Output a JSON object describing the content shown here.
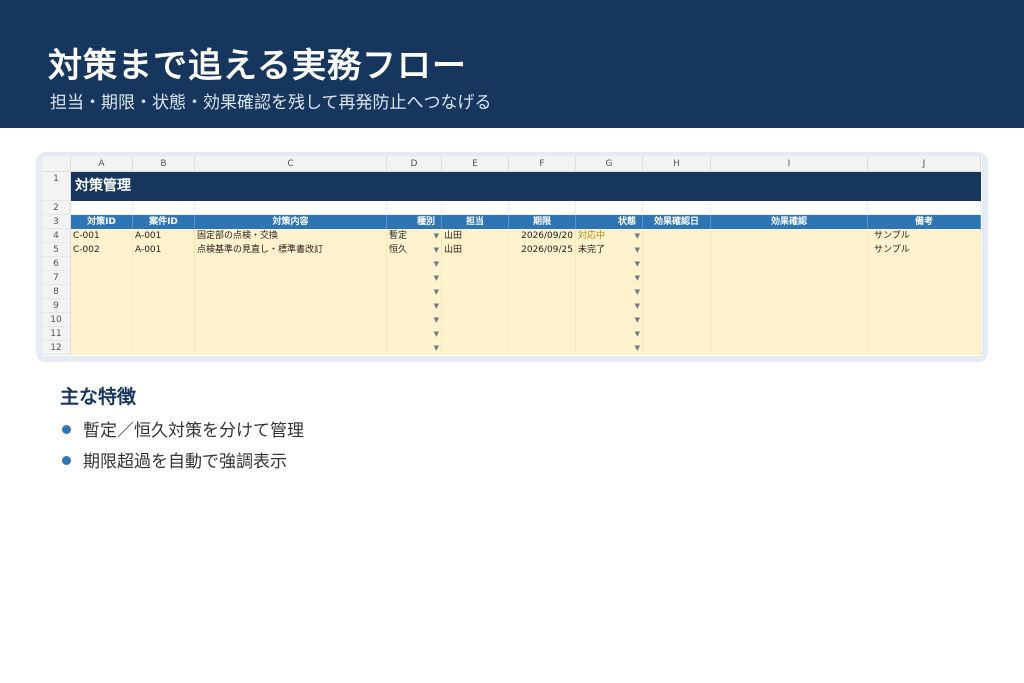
{
  "header": {
    "title": "対策まで追える実務フロー",
    "subtitle": "担当・期限・状態・効果確認を残して再発防止へつなげる"
  },
  "sheet": {
    "columns": [
      "A",
      "B",
      "C",
      "D",
      "E",
      "F",
      "G",
      "H",
      "I",
      "J"
    ],
    "rows": [
      "1",
      "2",
      "3",
      "4",
      "5",
      "6",
      "7",
      "8",
      "9",
      "10",
      "11",
      "12"
    ],
    "banner": "対策管理",
    "headers": [
      "対策ID",
      "案件ID",
      "対策内容",
      "種別",
      "担当",
      "期限",
      "状態",
      "効果確認日",
      "効果確認",
      "備考"
    ],
    "data": [
      {
        "id": "C-001",
        "case": "A-001",
        "content": "固定部の点検・交換",
        "type": "暫定",
        "owner": "山田",
        "due": "2026/09/20",
        "status": "対応中",
        "check_date": "",
        "check": "",
        "note": "サンプル"
      },
      {
        "id": "C-002",
        "case": "A-001",
        "content": "点検基準の見直し・標準書改訂",
        "type": "恒久",
        "owner": "山田",
        "due": "2026/09/25",
        "status": "未完了",
        "check_date": "",
        "check": "",
        "note": "サンプル"
      }
    ],
    "colors": {
      "banner": "#17365d",
      "header": "#2e75b6",
      "data_fill": "#fff2cc",
      "status_in_progress": "#b8860b"
    }
  },
  "features": {
    "title": "主な特徴",
    "items": [
      "暫定／恒久対策を分けて管理",
      "期限超過を自動で強調表示"
    ]
  }
}
